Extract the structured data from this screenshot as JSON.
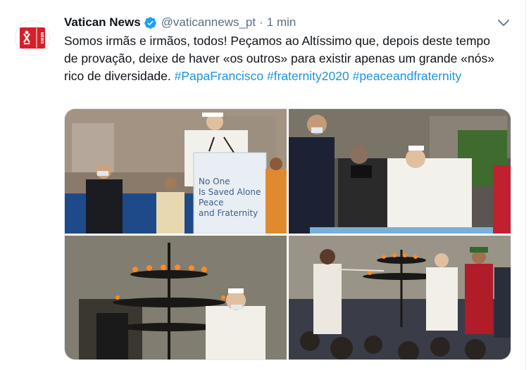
{
  "tweet": {
    "display_name": "Vatican News",
    "verified": true,
    "handle": "@vaticannews_pt",
    "separator": "·",
    "time": "1 min",
    "text_plain": "Somos irmãs e irmãos, todos! Peçamos ao Altíssimo que, depois deste tempo de provação, deixe de haver «os outros» para existir apenas um grande «nós» rico de diversidade. ",
    "hashtags": [
      "#PapaFrancisco",
      "#fraternity2020",
      "#peaceandfraternity"
    ]
  },
  "avatar": {
    "label": "NEWS",
    "color": "#d4202a"
  },
  "media": {
    "photos": [
      {
        "sign_lines": [
          "No One",
          "Is Saved Alone",
          "Peace",
          "and Fraternity"
        ]
      },
      {},
      {},
      {}
    ]
  },
  "colors": {
    "link": "#1b95e0",
    "secondary_text": "#5b7083",
    "verified_badge": "#1da1f2",
    "border": "#e1e8ed"
  },
  "icons": {
    "verified": "verified-badge-icon",
    "menu": "chevron-down-icon"
  }
}
